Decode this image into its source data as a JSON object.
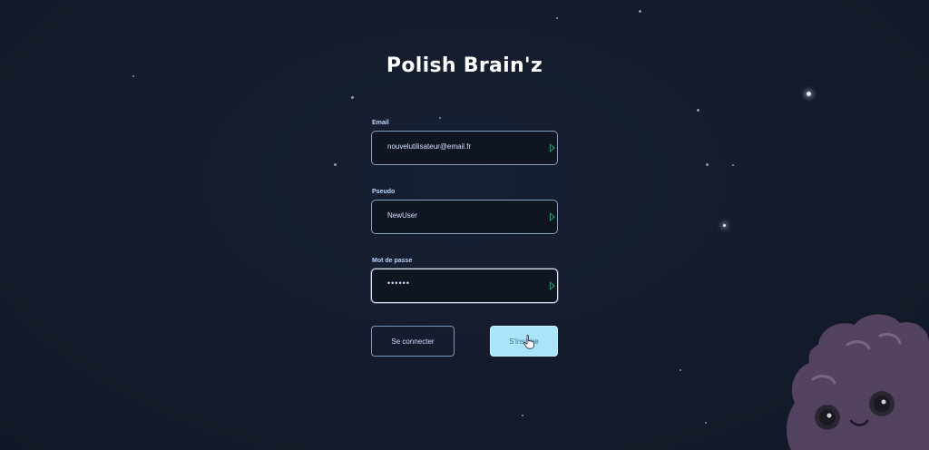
{
  "app": {
    "title": "Polish Brain'z"
  },
  "form": {
    "email": {
      "label": "Email",
      "value": "nouvelutilisateur@email.fr"
    },
    "pseudo": {
      "label": "Pseudo",
      "value": "NewUser"
    },
    "password": {
      "label": "Mot de passe",
      "value": "••••••"
    }
  },
  "buttons": {
    "login_label": "Se connecter",
    "signup_label": "S'inscrire"
  },
  "colors": {
    "background": "#151c2c",
    "accent": "#a9e4fb",
    "input_border": "#8aa3c4",
    "mascot": "#5b4766"
  },
  "icons": {
    "field_submit": "play-arrow-icon",
    "cursor": "hand-pointer-icon",
    "mascot": "brain-mascot"
  }
}
